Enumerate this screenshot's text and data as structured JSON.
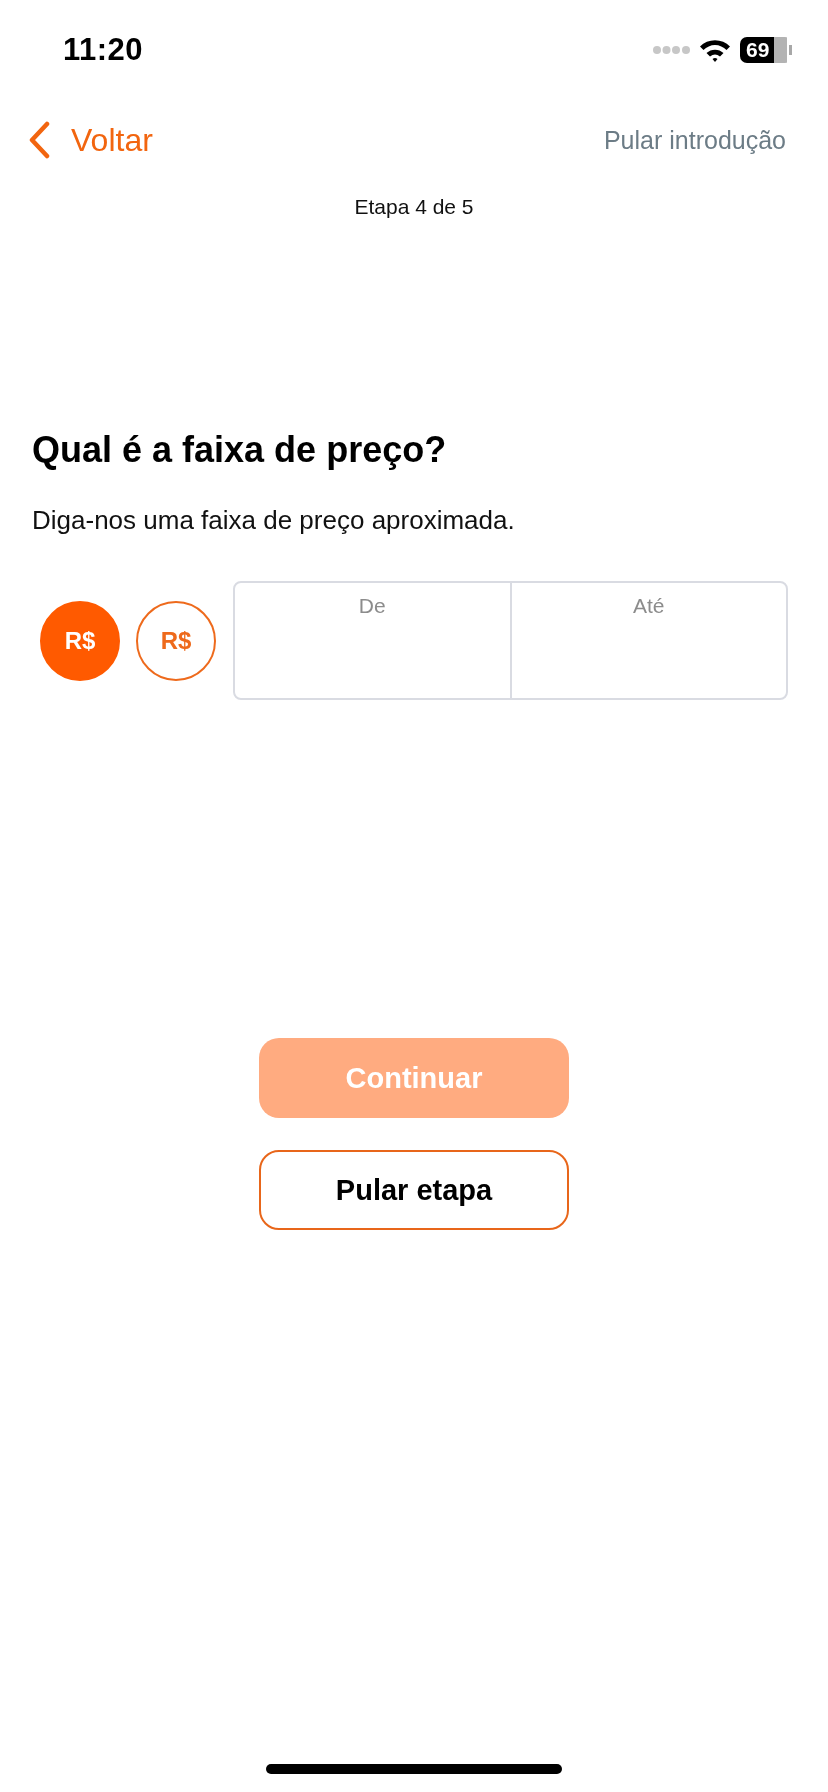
{
  "status_bar": {
    "time": "11:20",
    "battery": "69"
  },
  "nav": {
    "back": "Voltar",
    "skip_intro": "Pular introdução"
  },
  "step": "Etapa 4 de 5",
  "question": {
    "title": "Qual é a faixa de preço?",
    "subtitle": "Diga-nos uma faixa de preço aproximada."
  },
  "currency_options": [
    {
      "label": "R$",
      "selected": true
    },
    {
      "label": "R$",
      "selected": false
    }
  ],
  "range_fields": [
    {
      "label": "De"
    },
    {
      "label": "Até"
    }
  ],
  "buttons": [
    {
      "kind": "primary",
      "label": "Continuar",
      "disabled": true
    },
    {
      "kind": "secondary",
      "label": "Pular etapa",
      "disabled": false
    }
  ]
}
